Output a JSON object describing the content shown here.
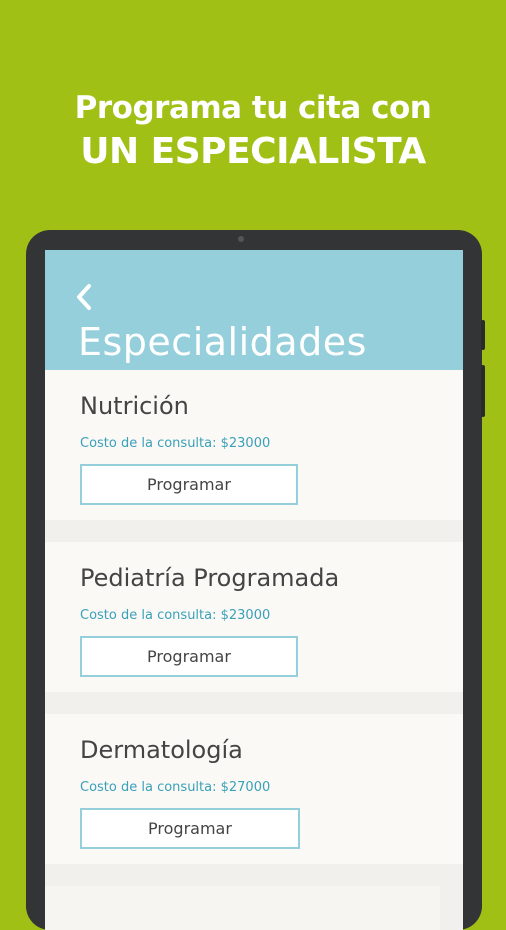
{
  "promo": {
    "line1": "Programa tu cita con",
    "line2": "UN ESPECIALISTA"
  },
  "header": {
    "back_icon": "chevron-left-icon",
    "title": "Especialidades"
  },
  "specialties": [
    {
      "name": "Nutrición",
      "cost": "Costo de la consulta: $23000",
      "button": "Programar"
    },
    {
      "name": "Pediatría Programada",
      "cost": "Costo de la consulta: $23000",
      "button": "Programar"
    },
    {
      "name": "Dermatología",
      "cost": "Costo de la consulta: $27000",
      "button": "Programar"
    }
  ],
  "colors": {
    "background": "#a0c016",
    "header": "#94cfdb",
    "accent_text": "#3aa0b8",
    "device_frame": "#333435"
  }
}
